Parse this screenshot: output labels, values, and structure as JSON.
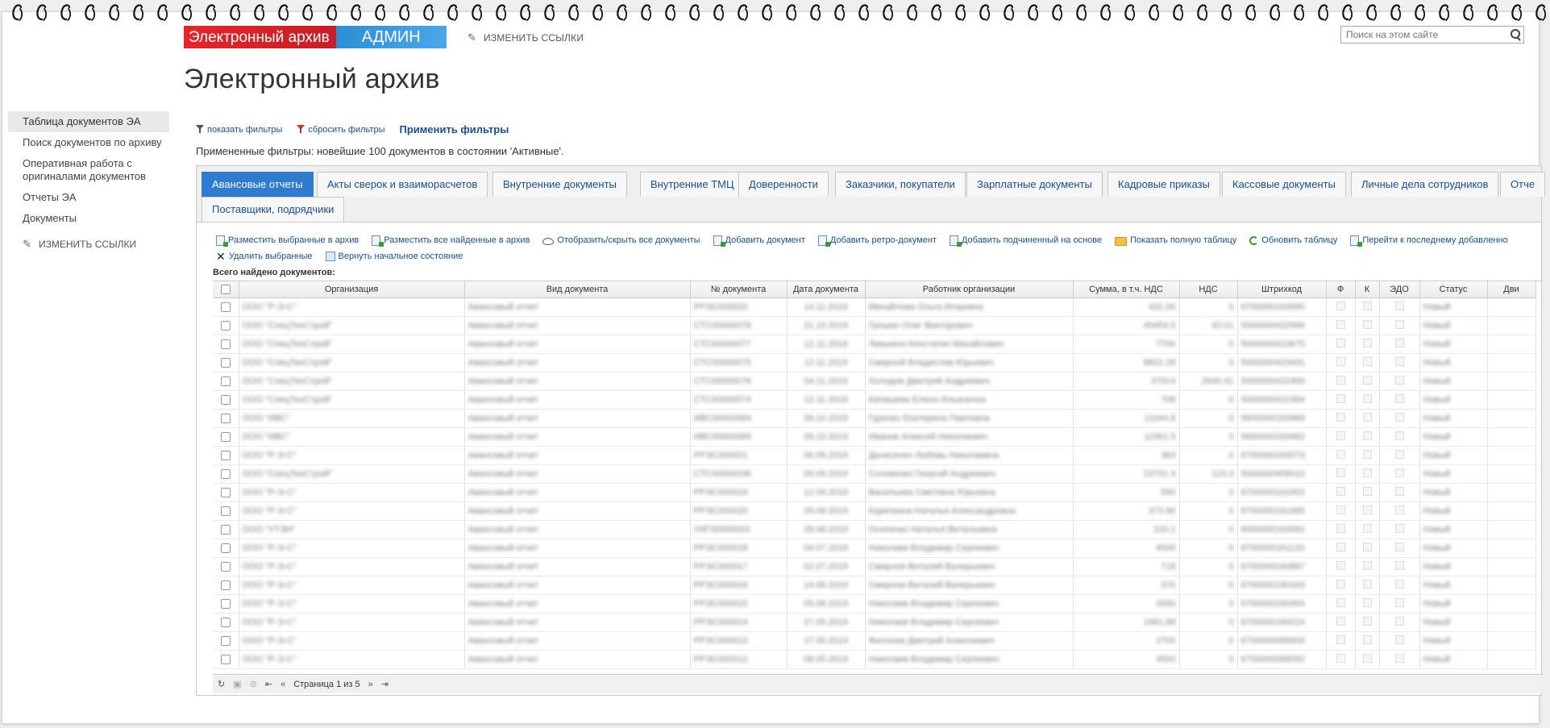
{
  "header": {
    "banner_left": "Электронный архив",
    "banner_right": "АДМИН",
    "edit_links": "ИЗМЕНИТЬ ССЫЛКИ",
    "search_placeholder": "Поиск на этом сайте",
    "page_title": "Электронный архив"
  },
  "sidebar": {
    "items": [
      {
        "label": "Таблица документов ЭА"
      },
      {
        "label": "Поиск документов по архиву"
      },
      {
        "label": "Оперативная работа с оригиналами документов"
      },
      {
        "label": "Отчеты ЭА"
      },
      {
        "label": "Документы"
      }
    ],
    "edit_links": "ИЗМЕНИТЬ ССЫЛКИ"
  },
  "filters": {
    "show": "показать фильтры",
    "reset": "сбросить фильтры",
    "apply": "Применить фильтры",
    "applied_text": "Примененные фильтры: новейшие 100 документов в состоянии 'Активные'."
  },
  "tabs": [
    "Авансовые отчеты",
    "Акты сверок и взаиморасчетов",
    "Внутренние документы",
    "Внутренние ТМЦ",
    "Доверенности",
    "Заказчики, покупатели",
    "Зарплатные документы",
    "Кадровые приказы",
    "Кассовые документы",
    "Личные дела сотрудников",
    "Отче",
    "Поставщики, подрядчики"
  ],
  "toolbar": {
    "place_selected": "Разместить выбранные в архив",
    "place_all": "Разместить все найденные в архив",
    "toggle_all": "Отобразить/скрыть все документы",
    "add_doc": "Добавить документ",
    "add_retro": "Добавить ретро-документ",
    "add_child": "Добавить подчиненный на основе",
    "show_full": "Показать полную таблицу",
    "refresh": "Обновить таблицу",
    "goto_last": "Перейти к последнему добавленно",
    "delete_selected": "Удалить выбранные",
    "reset_state": "Вернуть начальное состояние"
  },
  "grid": {
    "found_label": "Всего найдено документов:",
    "columns": [
      "Организация",
      "Вид документа",
      "№ документа",
      "Дата документа",
      "Работник организации",
      "Сумма, в т.ч. НДС",
      "НДС",
      "Штрихкод",
      "Ф",
      "К",
      "ЭДО",
      "Статус",
      "Дви"
    ],
    "rows": [
      {
        "org": "ООО \"Р-Э-С\"",
        "kind": "Авансовый отчет",
        "num": "РРЭС000033",
        "date": "14.11.2019",
        "worker": "Михайлова Ольга Игоревна",
        "sum": "431.00",
        "vat": "0",
        "barcode": "6700000163990",
        "status": "Новый"
      },
      {
        "org": "ООО \"СпецТехСтрой\"",
        "kind": "Авансовый отчет",
        "num": "СТС00000078",
        "date": "21.10.2019",
        "worker": "Грошин Олег Викторович",
        "sum": "45454.5",
        "vat": "42.01",
        "barcode": "5000000422966",
        "status": "Новый"
      },
      {
        "org": "ООО \"СпецТехСтрой\"",
        "kind": "Авансовый отчет",
        "num": "СТС00000077",
        "date": "12.11.2019",
        "worker": "Левшина Констатин Михайлович",
        "sum": "7700",
        "vat": "0",
        "barcode": "5000000423675",
        "status": "Новый"
      },
      {
        "org": "ООО \"СпецТехСтрой\"",
        "kind": "Авансовый отчет",
        "num": "СТС00000075",
        "date": "12.11.2019",
        "worker": "Смирной Владислав Юрьевич",
        "sum": "8822.29",
        "vat": "0",
        "barcode": "5000000423431",
        "status": "Новый"
      },
      {
        "org": "ООО \"СпецТехСтрой\"",
        "kind": "Авансовый отчет",
        "num": "СТС00000076",
        "date": "04.11.2019",
        "worker": "Холодов Дмитрий Андреевич",
        "sum": "37914",
        "vat": "2945.41",
        "barcode": "5000000422400",
        "status": "Новый"
      },
      {
        "org": "ООО \"СпецТехСтрой\"",
        "kind": "Авансовый отчет",
        "num": "СТС00000074",
        "date": "12.11.2019",
        "worker": "Кипяшева Елена Ильинична",
        "sum": "708",
        "vat": "0",
        "barcode": "5000000422384",
        "status": "Новый"
      },
      {
        "org": "ООО \"ИВС\"",
        "kind": "Авансовый отчет",
        "num": "ИВС00000084",
        "date": "28.10.2019",
        "worker": "Гуренко Екатерина Павловна",
        "sum": "11044.6",
        "vat": "0",
        "barcode": "5600000163989",
        "status": "Новый"
      },
      {
        "org": "ООО \"ИВС\"",
        "kind": "Авансовый отчет",
        "num": "ИВС00000085",
        "date": "29.10.2019",
        "worker": "Иванов Алексей Николаевич",
        "sum": "11561.5",
        "vat": "0",
        "barcode": "5600000163962",
        "status": "Новый"
      },
      {
        "org": "ООО \"Р-Э-С\"",
        "kind": "Авансовый отчет",
        "num": "РРЭС000021",
        "date": "06.09.2019",
        "worker": "Денисенко Любовь Николаевна",
        "sum": "363",
        "vat": "0",
        "barcode": "6700000163073",
        "status": "Новый"
      },
      {
        "org": "ООО \"СпецТехСтрой\"",
        "kind": "Авансовый отчет",
        "num": "СТС00000036",
        "date": "09.09.2019",
        "worker": "Соловенко Георгий Андреевич",
        "sum": "23701.4",
        "vat": "123.3",
        "barcode": "5000000409010",
        "status": "Новый"
      },
      {
        "org": "ООО \"Р-Э-С\"",
        "kind": "Авансовый отчет",
        "num": "РРЭС000019",
        "date": "12.09.2019",
        "worker": "Васильева Светлана Юрьевна",
        "sum": "550",
        "vat": "0",
        "barcode": "6700000161002",
        "status": "Новый"
      },
      {
        "org": "ООО \"Р-Э-С\"",
        "kind": "Авансовый отчет",
        "num": "РРЭС000020",
        "date": "29.08.2019",
        "worker": "Карепкина Наталья Александровна",
        "sum": "373.60",
        "vat": "0",
        "barcode": "6700000161685",
        "status": "Новый"
      },
      {
        "org": "ООО \"УТЭН\"",
        "kind": "Авансовый отчет",
        "num": "УИГ00000003",
        "date": "29.08.2019",
        "worker": "Осипенко Наталья Витальевна",
        "sum": "220.1",
        "vat": "0",
        "barcode": "6000000163062",
        "status": "Новый"
      },
      {
        "org": "ООО \"Р-Э-С\"",
        "kind": "Авансовый отчет",
        "num": "РРЭС000018",
        "date": "04.07.2019",
        "worker": "Николаев Владимир Сергеевич",
        "sum": "4500",
        "vat": "0",
        "barcode": "6700000161120",
        "status": "Новый"
      },
      {
        "org": "ООО \"Р-Э-С\"",
        "kind": "Авансовый отчет",
        "num": "РРЭС000017",
        "date": "02.07.2019",
        "worker": "Смирнов Виталий Валерьевич",
        "sum": "718",
        "vat": "0",
        "barcode": "6700000160887",
        "status": "Новый"
      },
      {
        "org": "ООО \"Р-Э-С\"",
        "kind": "Авансовый отчет",
        "num": "РРЭС000016",
        "date": "14.06.2019",
        "worker": "Смирнов Виталий Валерьевич",
        "sum": "370",
        "vat": "0",
        "barcode": "6700000160343",
        "status": "Новый"
      },
      {
        "org": "ООО \"Р-Э-С\"",
        "kind": "Авансовый отчет",
        "num": "РРЭС000015",
        "date": "05.06.2019",
        "worker": "Николаев Владимир Сергеевич",
        "sum": "2650",
        "vat": "0",
        "barcode": "6700000160454",
        "status": "Новый"
      },
      {
        "org": "ООО \"Р-Э-С\"",
        "kind": "Авансовый отчет",
        "num": "РРЭС000014",
        "date": "27.05.2019",
        "worker": "Николаев Владимир Сергеевич",
        "sum": "1661.68",
        "vat": "0",
        "barcode": "6700000160024",
        "status": "Новый"
      },
      {
        "org": "ООО \"Р-Э-С\"",
        "kind": "Авансовый отчет",
        "num": "РРЭС000013",
        "date": "17.05.2019",
        "worker": "Филонов Дмитрий Алексеевич",
        "sum": "2700",
        "vat": "0",
        "barcode": "6700000099900",
        "status": "Новый"
      },
      {
        "org": "ООО \"Р-Э-С\"",
        "kind": "Авансовый отчет",
        "num": "РРЭС000012",
        "date": "08.05.2019",
        "worker": "Николаев Владимир Сергеевич",
        "sum": "4500",
        "vat": "0",
        "barcode": "6700000099092",
        "status": "Новый"
      }
    ]
  },
  "pager": {
    "text": "Страница 1 из 5"
  }
}
